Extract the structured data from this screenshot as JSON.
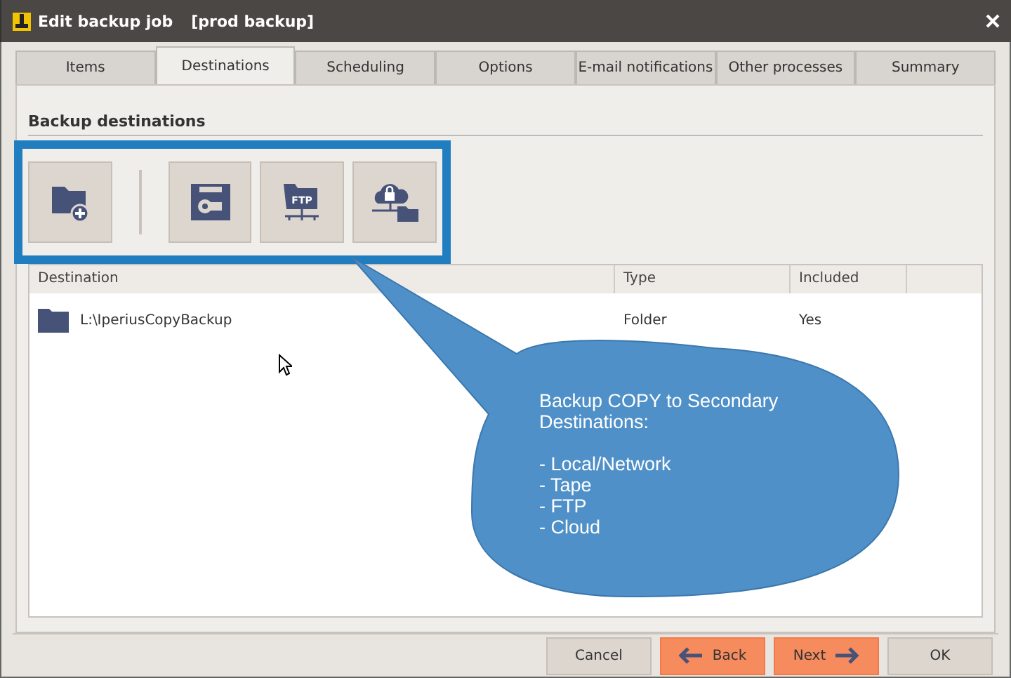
{
  "window": {
    "title": "Edit backup job",
    "subtitle": "[prod backup]"
  },
  "tabs": [
    {
      "label": "Items",
      "selected": false
    },
    {
      "label": "Destinations",
      "selected": true
    },
    {
      "label": "Scheduling",
      "selected": false
    },
    {
      "label": "Options",
      "selected": false
    },
    {
      "label": "E-mail notifications",
      "selected": false
    },
    {
      "label": "Other processes",
      "selected": false
    },
    {
      "label": "Summary",
      "selected": false
    }
  ],
  "section": {
    "title": "Backup destinations"
  },
  "toolbar": [
    {
      "kind": "folder-add"
    },
    {
      "kind": "separator"
    },
    {
      "kind": "tape"
    },
    {
      "kind": "ftp",
      "label": "FTP"
    },
    {
      "kind": "cloud"
    }
  ],
  "table": {
    "columns": [
      "Destination",
      "Type",
      "Included"
    ],
    "rows": [
      {
        "destination": "L:\\IperiusCopyBackup",
        "type": "Folder",
        "included": "Yes"
      }
    ]
  },
  "callout": {
    "heading": "Backup COPY to Secondary Destinations:",
    "items": [
      "- Local/Network",
      "- Tape",
      "- FTP",
      "- Cloud"
    ]
  },
  "buttons": [
    {
      "label": "Cancel",
      "kind": "plain"
    },
    {
      "label": "Back",
      "kind": "back"
    },
    {
      "label": "Next",
      "kind": "next"
    },
    {
      "label": "OK",
      "kind": "plain"
    }
  ]
}
